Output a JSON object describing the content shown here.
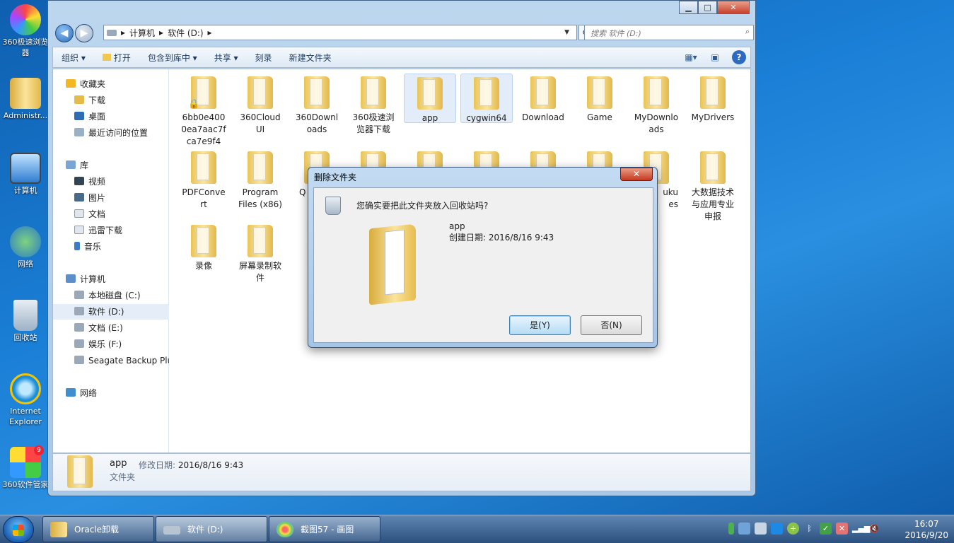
{
  "desktop": {
    "icons": [
      {
        "label": "360极速浏览器"
      },
      {
        "label": "Administr..."
      },
      {
        "label": "计算机"
      },
      {
        "label": "网络"
      },
      {
        "label": "回收站"
      },
      {
        "label": "Internet Explorer"
      },
      {
        "label": "360软件管家",
        "badge": "9"
      }
    ]
  },
  "window": {
    "controls": {
      "minimize": "▁",
      "maximize": "□",
      "close": "✕"
    },
    "address": {
      "segments": [
        "计算机",
        "软件 (D:)"
      ],
      "separator": "▸"
    },
    "search": {
      "placeholder": "搜索 软件 (D:)"
    },
    "toolbar": {
      "organize": "组织 ▾",
      "open": "打开",
      "include": "包含到库中 ▾",
      "share": "共享 ▾",
      "burn": "刻录",
      "new_folder": "新建文件夹"
    },
    "nav": {
      "favorites": "收藏夹",
      "downloads": "下载",
      "desktop": "桌面",
      "recent": "最近访问的位置",
      "libraries": "库",
      "videos": "视频",
      "pictures": "图片",
      "documents": "文档",
      "xunlei": "迅雷下载",
      "music": "音乐",
      "computer": "计算机",
      "drive_c": "本地磁盘 (C:)",
      "drive_d": "软件 (D:)",
      "drive_e": "文档 (E:)",
      "drive_f": "娱乐 (F:)",
      "seagate": "Seagate Backup Plu",
      "network": "网络"
    },
    "items": [
      [
        "6bb0e400",
        "0ea7aac7f",
        "ca7e9f4"
      ],
      [
        "360Cloud",
        "UI"
      ],
      [
        "360Downl",
        "oads"
      ],
      [
        "360极速浏",
        "览器下载"
      ],
      [
        "app"
      ],
      [
        "cygwin64"
      ],
      [
        "Download"
      ],
      [
        "Game"
      ],
      [
        "MyDownlo",
        "ads"
      ],
      [
        "MyDrivers"
      ],
      [
        "PDFConve",
        "rt"
      ],
      [
        "Program",
        "Files (x86)"
      ],
      [
        "Q"
      ],
      [
        "uku",
        "es"
      ],
      [
        "大数据技术",
        "与应用专业",
        "申报"
      ],
      [
        "录像"
      ],
      [
        "屏幕录制软",
        "件"
      ]
    ],
    "details": {
      "name": "app",
      "modified_label": "修改日期:",
      "modified_value": "2016/8/16 9:43",
      "type": "文件夹"
    }
  },
  "dialog": {
    "title": "删除文件夹",
    "close": "✕",
    "question": "您确实要把此文件夹放入回收站吗?",
    "folder_name": "app",
    "created": "创建日期: 2016/8/16 9:43",
    "yes": "是(Y)",
    "no": "否(N)"
  },
  "taskbar": {
    "tasks": [
      "Oracle卸载",
      "软件 (D:)",
      "截图57 - 画图"
    ],
    "time": "16:07",
    "date": "2016/9/20"
  },
  "colors": {
    "accent": "#1c5db0",
    "folder": "#f3d577",
    "selection": "#e2edf9"
  }
}
